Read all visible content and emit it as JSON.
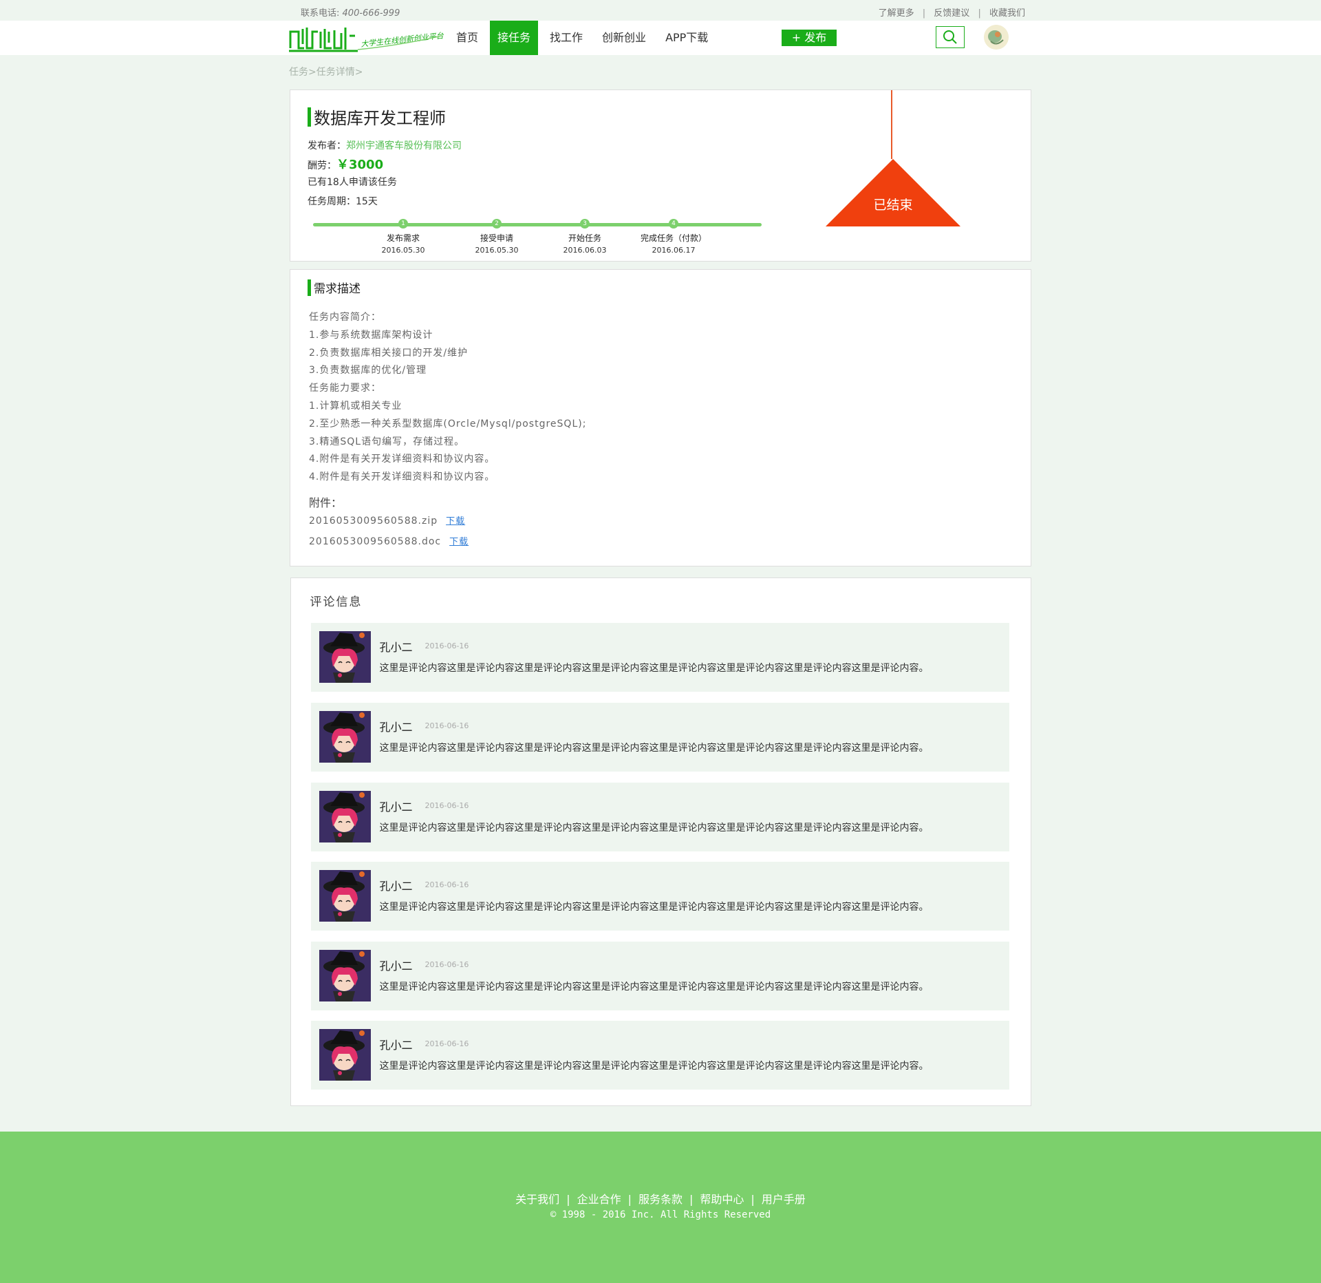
{
  "topbar": {
    "phone_label": "联系电话:",
    "phone_number": "400-666-999",
    "links": [
      "了解更多",
      "反馈建议",
      "收藏我们"
    ],
    "separator": "|"
  },
  "header": {
    "logo_text": "创新创业",
    "logo_slogan": "大学生在线创新创业平台",
    "nav": [
      "首页",
      "接任务",
      "找工作",
      "创新创业",
      "APP下载"
    ],
    "active_nav": "接任务",
    "publish_label": "+ 发布"
  },
  "breadcrumb": {
    "items": [
      "任务",
      "任务详情"
    ],
    "separator": ">"
  },
  "task": {
    "title": "数据库开发工程师",
    "publisher_label": "发布者：",
    "publisher": "郑州宇通客车股份有限公司",
    "reward_label": "酬劳：",
    "reward": "￥3000",
    "applicants": "已有18人申请该任务",
    "period_label": "任务周期：",
    "period": "15天",
    "status": "已结束",
    "steps": [
      {
        "num": "1",
        "label": "发布需求",
        "date": "2016.05.30"
      },
      {
        "num": "2",
        "label": "接受申请",
        "date": "2016.05.30"
      },
      {
        "num": "3",
        "label": "开始任务",
        "date": "2016.06.03"
      },
      {
        "num": "4",
        "label": "完成任务（付款）",
        "date": "2016.06.17"
      }
    ]
  },
  "description": {
    "title": "需求描述",
    "lines": [
      "任务内容简介：",
      "1.参与系统数据库架构设计",
      "2.负责数据库相关接口的开发/维护",
      "3.负责数据库的优化/管理",
      "任务能力要求：",
      "1.计算机或相关专业",
      "2.至少熟悉一种关系型数据库(Orcle/Mysql/postgreSQL);",
      "3.精通SQL语句编写，存储过程。",
      "4.附件是有关开发详细资料和协议内容。",
      "4.附件是有关开发详细资料和协议内容。"
    ],
    "attach_title": "附件：",
    "files": [
      {
        "name": "2016053009560588.zip",
        "action": "下载"
      },
      {
        "name": "2016053009560588.doc",
        "action": "下载"
      }
    ]
  },
  "comments": {
    "title": "评论信息",
    "items": [
      {
        "name": "孔小二",
        "time": "2016-06-16",
        "text": "这里是评论内容这里是评论内容这里是评论内容这里是评论内容这里是评论内容这里是评论内容这里是评论内容这里是评论内容。"
      },
      {
        "name": "孔小二",
        "time": "2016-06-16",
        "text": "这里是评论内容这里是评论内容这里是评论内容这里是评论内容这里是评论内容这里是评论内容这里是评论内容这里是评论内容。"
      },
      {
        "name": "孔小二",
        "time": "2016-06-16",
        "text": "这里是评论内容这里是评论内容这里是评论内容这里是评论内容这里是评论内容这里是评论内容这里是评论内容这里是评论内容。"
      },
      {
        "name": "孔小二",
        "time": "2016-06-16",
        "text": "这里是评论内容这里是评论内容这里是评论内容这里是评论内容这里是评论内容这里是评论内容这里是评论内容这里是评论内容。"
      },
      {
        "name": "孔小二",
        "time": "2016-06-16",
        "text": "这里是评论内容这里是评论内容这里是评论内容这里是评论内容这里是评论内容这里是评论内容这里是评论内容这里是评论内容。"
      },
      {
        "name": "孔小二",
        "time": "2016-06-16",
        "text": "这里是评论内容这里是评论内容这里是评论内容这里是评论内容这里是评论内容这里是评论内容这里是评论内容这里是评论内容。"
      }
    ]
  },
  "footer": {
    "links": [
      "关于我们",
      "企业合作",
      "服务条款",
      "帮助中心",
      "用户手册"
    ],
    "separator": "|",
    "copyright": "© 1998 - 2016  Inc. All Rights Reserved"
  },
  "colors": {
    "accent": "#1aad19",
    "footer": "#7cd06c",
    "ended": "#f0400e",
    "page_bg": "#eef5ef"
  },
  "icons": {
    "search": "search-icon",
    "user_avatar": "user-avatar-icon",
    "comment_avatar": "comment-avatar-icon"
  }
}
